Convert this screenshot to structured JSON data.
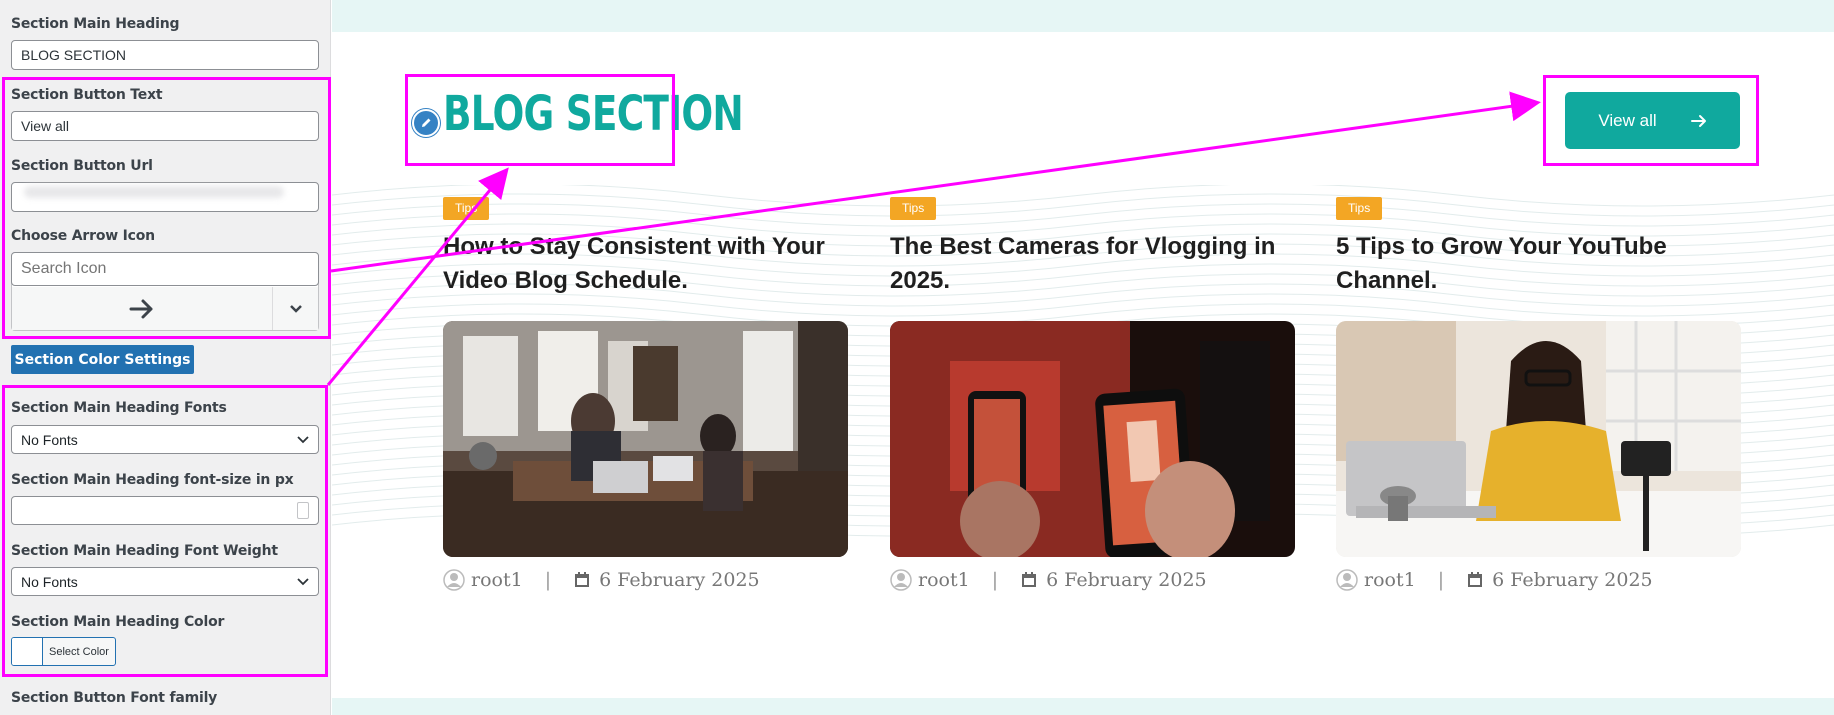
{
  "sidebar": {
    "main_heading_label": "Section Main Heading",
    "main_heading_value": "BLOG SECTION",
    "button_text_label": "Section Button Text",
    "button_text_value": "View all",
    "button_url_label": "Section Button Url",
    "arrow_icon_label": "Choose Arrow Icon",
    "icon_search_placeholder": "Search Icon",
    "color_settings_button": "Section Color Settings",
    "heading_fonts_label": "Section Main Heading Fonts",
    "heading_fonts_value": "No Fonts",
    "heading_font_size_label": "Section Main Heading font-size in px",
    "heading_font_weight_label": "Section Main Heading Font Weight",
    "heading_font_weight_value": "No Fonts",
    "heading_color_label": "Section Main Heading Color",
    "select_color_label": "Select Color",
    "button_font_family_label": "Section Button Font family"
  },
  "preview": {
    "section_title": "BLOG SECTION",
    "view_all_label": "View all",
    "posts": [
      {
        "tag": "Tips",
        "title": "How to Stay Consistent with Your Video Blog Schedule.",
        "author": "root1",
        "date": "6 February 2025"
      },
      {
        "tag": "Tips",
        "title": "The Best Cameras for Vlogging in 2025.",
        "author": "root1",
        "date": "6 February 2025"
      },
      {
        "tag": "Tips",
        "title": "5 Tips to Grow Your YouTube Channel.",
        "author": "root1",
        "date": "6 February 2025"
      }
    ]
  },
  "colors": {
    "accent": "#10a99e",
    "tag": "#f3a624",
    "annotation": "#ff00ff",
    "wp_blue": "#2271b1"
  },
  "icons": [
    "arrow-right-icon",
    "chevron-down-icon",
    "pencil-icon",
    "user-icon",
    "calendar-icon"
  ]
}
